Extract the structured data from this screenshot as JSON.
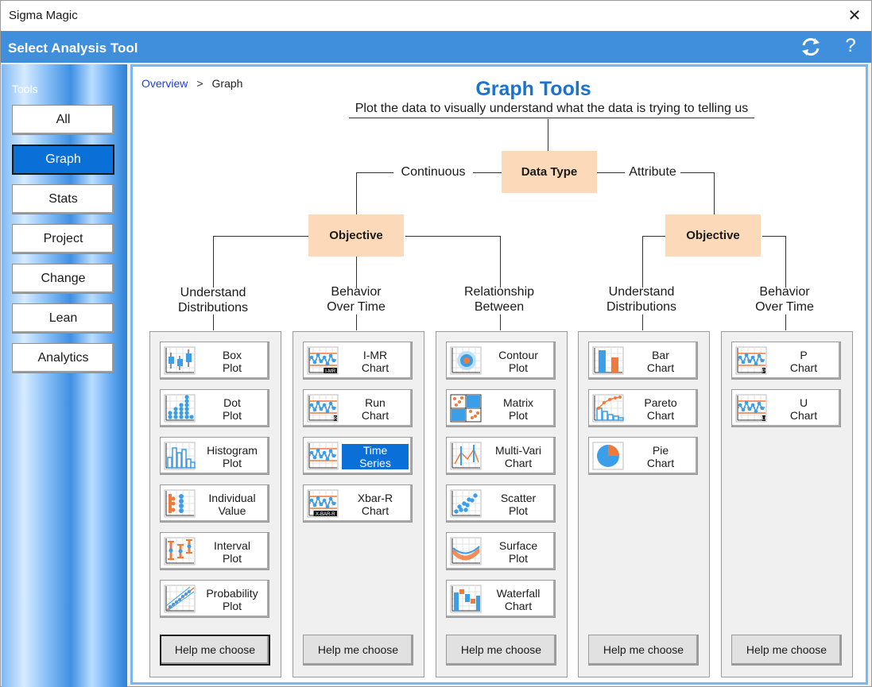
{
  "window": {
    "title": "Sigma Magic",
    "close_glyph": "✕"
  },
  "header": {
    "title": "Select Analysis Tool",
    "help_glyph": "?"
  },
  "sidebar": {
    "label": "Tools",
    "items": [
      {
        "label": "All"
      },
      {
        "label": "Graph",
        "active": true
      },
      {
        "label": "Stats"
      },
      {
        "label": "Project"
      },
      {
        "label": "Change"
      },
      {
        "label": "Lean"
      },
      {
        "label": "Analytics"
      }
    ]
  },
  "breadcrumb": {
    "link": "Overview",
    "separator": ">",
    "current": "Graph"
  },
  "main": {
    "title": "Graph Tools",
    "subtitle": "Plot the data to visually understand what the data is trying to telling us",
    "root_box": "Data Type",
    "branch_left": "Continuous",
    "branch_right": "Attribute",
    "objective_left": "Objective",
    "objective_right": "Objective"
  },
  "categories": [
    {
      "line1": "Understand",
      "line2": "Distributions"
    },
    {
      "line1": "Behavior",
      "line2": "Over Time"
    },
    {
      "line1": "Relationship",
      "line2": "Between"
    },
    {
      "line1": "Understand",
      "line2": "Distributions"
    },
    {
      "line1": "Behavior",
      "line2": "Over Time"
    }
  ],
  "panels": [
    {
      "tools": [
        {
          "line1": "Box",
          "line2": "Plot",
          "icon": "box-plot-icon"
        },
        {
          "line1": "Dot",
          "line2": "Plot",
          "icon": "dot-plot-icon"
        },
        {
          "line1": "Histogram",
          "line2": "Plot",
          "icon": "histogram-icon"
        },
        {
          "line1": "Individual",
          "line2": "Value",
          "icon": "individual-value-icon"
        },
        {
          "line1": "Interval",
          "line2": "Plot",
          "icon": "interval-plot-icon"
        },
        {
          "line1": "Probability",
          "line2": "Plot",
          "icon": "probability-plot-icon"
        }
      ],
      "help": "Help me choose"
    },
    {
      "tools": [
        {
          "line1": "I-MR",
          "line2": "Chart",
          "icon": "imr-chart-icon",
          "tag": "I-MR"
        },
        {
          "line1": "Run",
          "line2": "Chart",
          "icon": "run-chart-icon",
          "tag": "R"
        },
        {
          "line1": "Time",
          "line2": "Series",
          "icon": "time-series-icon",
          "selected": true
        },
        {
          "line1": "Xbar-R",
          "line2": "Chart",
          "icon": "xbar-r-chart-icon",
          "tag": "X-BAR-R"
        }
      ],
      "help": "Help me choose"
    },
    {
      "tools": [
        {
          "line1": "Contour",
          "line2": "Plot",
          "icon": "contour-plot-icon"
        },
        {
          "line1": "Matrix",
          "line2": "Plot",
          "icon": "matrix-plot-icon"
        },
        {
          "line1": "Multi-Vari",
          "line2": "Chart",
          "icon": "multi-vari-icon"
        },
        {
          "line1": "Scatter",
          "line2": "Plot",
          "icon": "scatter-plot-icon"
        },
        {
          "line1": "Surface",
          "line2": "Plot",
          "icon": "surface-plot-icon"
        },
        {
          "line1": "Waterfall",
          "line2": "Chart",
          "icon": "waterfall-chart-icon"
        }
      ],
      "help": "Help me choose"
    },
    {
      "tools": [
        {
          "line1": "Bar",
          "line2": "Chart",
          "icon": "bar-chart-icon"
        },
        {
          "line1": "Pareto",
          "line2": "Chart",
          "icon": "pareto-chart-icon"
        },
        {
          "line1": "Pie",
          "line2": "Chart",
          "icon": "pie-chart-icon"
        }
      ],
      "help": "Help me choose"
    },
    {
      "tools": [
        {
          "line1": "P",
          "line2": "Chart",
          "icon": "p-chart-icon",
          "tag": "P"
        },
        {
          "line1": "U",
          "line2": "Chart",
          "icon": "u-chart-icon",
          "tag": "U"
        }
      ],
      "help": "Help me choose"
    }
  ],
  "colors": {
    "accent_blue": "#3f8fdc",
    "selected_blue": "#0b6fd8",
    "peach": "#fcd9b8",
    "icon_blue": "#3a9ee8",
    "icon_orange": "#f07a3c"
  }
}
